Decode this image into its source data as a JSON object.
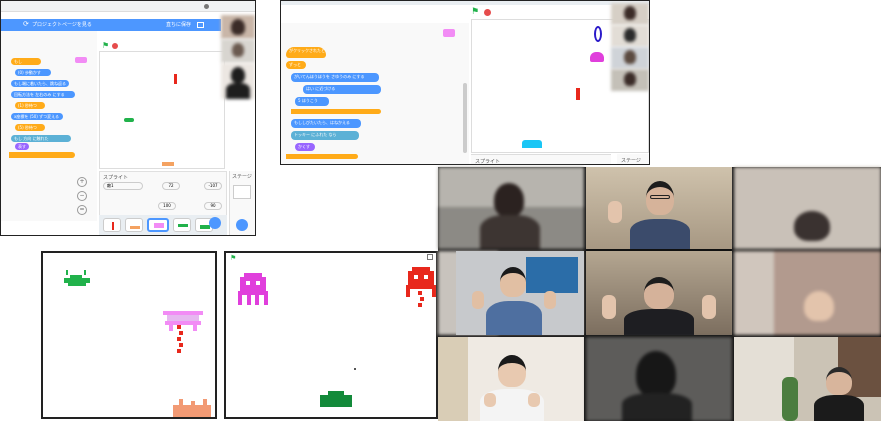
{
  "editor1": {
    "project_page_label": "プロジェクトページを見る",
    "save_label": "直ちに保存",
    "blocks": [
      "もし",
      "(0) 歩動かす",
      "もし端に着いたら、跳ね返る",
      "回転方法を 左右のみ にする",
      "(1) 秒待つ",
      "x座標を (50) ずつ変える",
      "(5) 秒待つ",
      "もし 方向 に触れた",
      "表す"
    ],
    "sprite_label": "スプライト",
    "sprite_name": "敵1",
    "x_value": "72",
    "y_value": "-107",
    "size_value": "100",
    "direction_value": "90",
    "stage_label": "ステージ",
    "backdrop_count": "1"
  },
  "editor2": {
    "blocks": [
      "がクリックされたとき",
      "ずっと",
      "がいてんほうほうを さゆうのみ にする",
      "はい に近づける",
      "5 ほうこう",
      "もししびたいたら、はねかえる",
      "トッキー にふれた なら",
      "かくす"
    ],
    "sprite_label": "スプライト",
    "stage_label": "ステージ"
  },
  "game_screens": {
    "left": "game-screen-left",
    "right": "game-screen-right"
  },
  "video_grid": {
    "participants": 9
  },
  "colors": {
    "scratch_orange": "#ffab19",
    "scratch_blue": "#4c97ff",
    "scratch_purple": "#9966ff",
    "sprite_green": "#21b24b",
    "sprite_pink": "#f28cf5",
    "sprite_red": "#e8281c",
    "sprite_magenta": "#e03fdc",
    "sprite_cyan": "#1ac6f5",
    "accent_blue": "#4d97ff"
  }
}
